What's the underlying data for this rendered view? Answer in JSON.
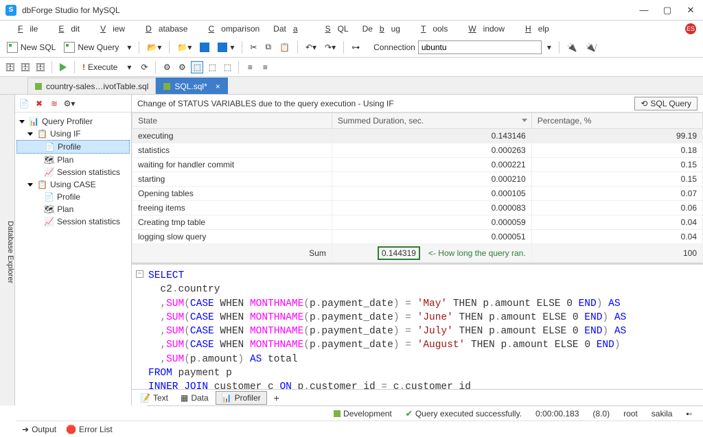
{
  "app": {
    "title": "dbForge Studio for MySQL",
    "logo_letter": "S"
  },
  "window_buttons": {
    "minimize": "—",
    "maximize": "▢",
    "close": "✕"
  },
  "menu": [
    "File",
    "Edit",
    "View",
    "Database",
    "Comparison",
    "Data",
    "SQL",
    "Debug",
    "Tools",
    "Window",
    "Help"
  ],
  "lang_badge": "ES",
  "toolbar1": {
    "new_sql": "New SQL",
    "new_query": "New Query",
    "execute": "Execute",
    "connection_label": "Connection",
    "connection_value": "ubuntu"
  },
  "doc_tabs": [
    {
      "label": "country-sales…ivotTable.sql",
      "active": false
    },
    {
      "label": "SQL.sql*",
      "active": true
    }
  ],
  "left_rail": "Database Explorer",
  "profiler_tree": {
    "root": "Query Profiler",
    "groups": [
      {
        "name": "Using IF",
        "items": [
          "Profile",
          "Plan",
          "Session statistics"
        ],
        "selected": "Profile"
      },
      {
        "name": "Using CASE",
        "items": [
          "Profile",
          "Plan",
          "Session statistics"
        ]
      }
    ]
  },
  "content_title": "Change of STATUS VARIABLES due to the query execution - Using IF",
  "sql_query_btn": "SQL Query",
  "grid": {
    "columns": [
      "State",
      "Summed Duration, sec.",
      "Percentage, %"
    ],
    "rows": [
      {
        "state": "executing",
        "dur": "0.143146",
        "pct": "99.19"
      },
      {
        "state": "statistics",
        "dur": "0.000263",
        "pct": "0.18"
      },
      {
        "state": "waiting for handler commit",
        "dur": "0.000221",
        "pct": "0.15"
      },
      {
        "state": "starting",
        "dur": "0.000210",
        "pct": "0.15"
      },
      {
        "state": "Opening tables",
        "dur": "0.000105",
        "pct": "0.07"
      },
      {
        "state": "freeing items",
        "dur": "0.000083",
        "pct": "0.06"
      },
      {
        "state": "Creating tmp table",
        "dur": "0.000059",
        "pct": "0.04"
      },
      {
        "state": "logging slow query",
        "dur": "0.000051",
        "pct": "0.04"
      }
    ],
    "footer": {
      "label": "Sum",
      "dur": "0.144319",
      "pct": "100",
      "annotation": "<- How long the query ran."
    }
  },
  "sql": {
    "l1a": "SELECT",
    "l2a": "  c2",
    "l2b": ".",
    "l2c": "country",
    "l3a": "  ,",
    "l3b": "SUM",
    "l3c": "(",
    "l3d": "CASE",
    "l3e": " WHEN ",
    "l3f": "MONTHNAME",
    "l3g": "(",
    "l3h": "p",
    "l3i": ".",
    "l3j": "payment_date",
    "l3k": ")",
    "l3l": " = ",
    "l3m": "'May'",
    "l3n": " THEN ",
    "l3o": "p",
    "l3p": ".",
    "l3q": "amount",
    "l3r": " ELSE ",
    "l3s": "0",
    "l3t": " END",
    "l3u": ")",
    "l3v": " AS",
    "l4m": "'June'",
    "l4v": " AS",
    "l5m": "'July'",
    "l5v": " AS",
    "l6m": "'August'",
    "l7a": "  ,",
    "l7b": "SUM",
    "l7c": "(",
    "l7d": "p",
    "l7e": ".",
    "l7f": "amount",
    "l7g": ")",
    "l7h": " AS",
    "l7i": " total",
    "l8a": "FROM",
    "l8b": " payment p",
    "l9a": "INNER",
    "l9b": " JOIN",
    "l9c": " customer c ",
    "l9d": "ON",
    "l9e": " p",
    "l9f": ".",
    "l9g": "customer_id ",
    "l9h": "=",
    "l9i": " c",
    "l9j": ".",
    "l9k": "customer_id"
  },
  "bottom_tabs": [
    "Text",
    "Data",
    "Profiler"
  ],
  "status": {
    "env": "Development",
    "msg": "Query executed successfully.",
    "time": "0:00:00.183",
    "version": "(8.0)",
    "user": "root",
    "schema": "sakila"
  },
  "output_tabs": {
    "output": "Output",
    "error_list": "Error List"
  }
}
